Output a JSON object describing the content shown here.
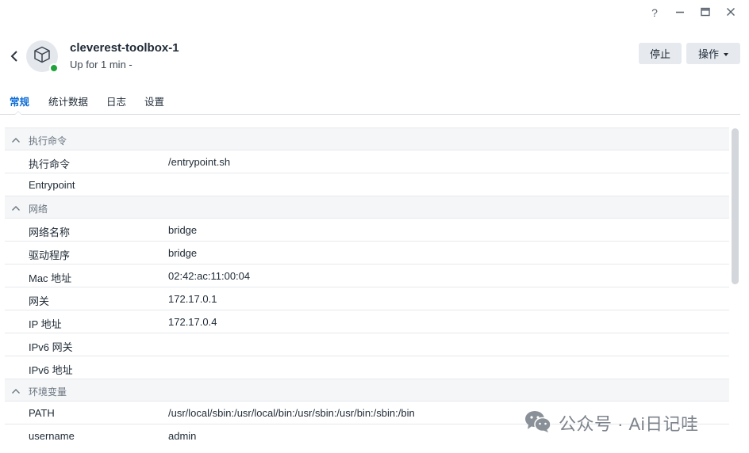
{
  "window": {
    "help_label": "?",
    "minimize_label": "—",
    "close_label": "✕"
  },
  "header": {
    "name": "cleverest-toolbox-1",
    "status": "Up for 1 min -",
    "status_color": "#1fa33a",
    "icon": "box-icon",
    "stop_label": "停止",
    "actions_label": "操作"
  },
  "tabs": [
    {
      "label": "常规",
      "active": true
    },
    {
      "label": "统计数据",
      "active": false
    },
    {
      "label": "日志",
      "active": false
    },
    {
      "label": "设置",
      "active": false
    }
  ],
  "sections": {
    "exec": {
      "title": "执行命令",
      "rows": [
        {
          "key": "执行命令",
          "value": "/entrypoint.sh"
        },
        {
          "key": "Entrypoint",
          "value": ""
        }
      ]
    },
    "network": {
      "title": "网络",
      "rows": [
        {
          "key": "网络名称",
          "value": "bridge"
        },
        {
          "key": "驱动程序",
          "value": "bridge"
        },
        {
          "key": "Mac 地址",
          "value": "02:42:ac:11:00:04"
        },
        {
          "key": "网关",
          "value": "172.17.0.1"
        },
        {
          "key": "IP 地址",
          "value": "172.17.0.4"
        },
        {
          "key": "IPv6 网关",
          "value": ""
        },
        {
          "key": "IPv6 地址",
          "value": ""
        }
      ]
    },
    "env": {
      "title": "环境变量",
      "rows": [
        {
          "key": "PATH",
          "value": "/usr/local/sbin:/usr/local/bin:/usr/sbin:/usr/bin:/sbin:/bin"
        },
        {
          "key": "username",
          "value": "admin"
        }
      ]
    }
  },
  "watermark": {
    "icon": "wechat-icon",
    "text": "公众号 · Ai日记哇"
  },
  "colors": {
    "accent": "#0c6bd6",
    "running": "#1fa33a"
  }
}
